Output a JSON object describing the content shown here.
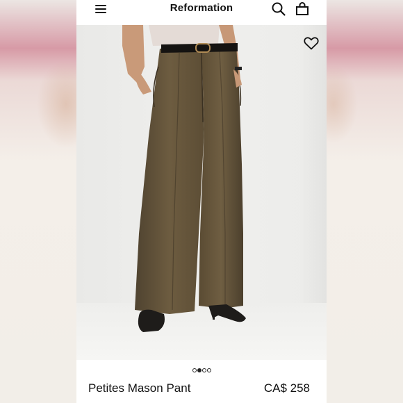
{
  "app": {
    "brand": "Reformation"
  },
  "header": {
    "menu_icon": "hamburger-menu-icon",
    "search_icon": "search-icon",
    "bag_icon": "shopping-bag-icon"
  },
  "hero": {
    "favorite_icon": "heart-outline-icon",
    "carousel": {
      "total": 4,
      "active_index": 1
    }
  },
  "product": {
    "name": "Petites Mason Pant",
    "price": "CA$ 258"
  },
  "colors": {
    "pant": "#6b5a3e",
    "accent": "#111111",
    "background": "#ffffff"
  }
}
